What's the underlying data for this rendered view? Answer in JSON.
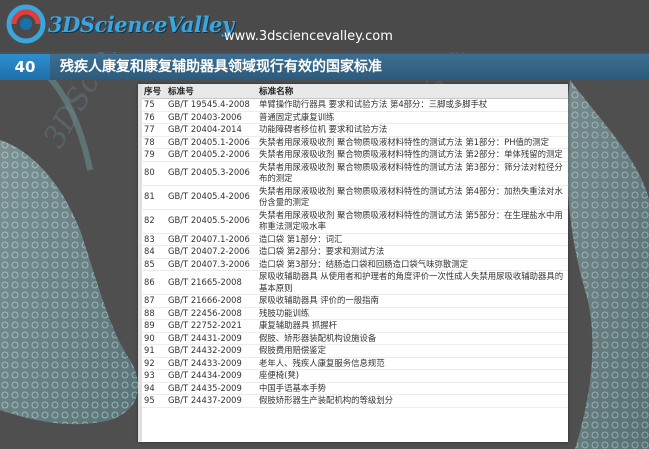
{
  "header": {
    "logo_text": "3DScienceValley",
    "url": "www.3dsciencevalley.com"
  },
  "title_bar": {
    "number": "40",
    "title": "残疾人康复和康复辅助器具领域现行有效的国家标准"
  },
  "table": {
    "headers": [
      "序号",
      "标准号",
      "标准名称"
    ],
    "rows": [
      {
        "no": "75",
        "code": "GB/T 19545.4-2008",
        "name": "单臂操作助行器具 要求和试验方法 第4部分：三脚或多脚手杖"
      },
      {
        "no": "76",
        "code": "GB/T 20403-2006",
        "name": "普通固定式康复训练"
      },
      {
        "no": "77",
        "code": "GB/T 20404-2014",
        "name": "功能障碍者移位机 要求和试验方法"
      },
      {
        "no": "78",
        "code": "GB/T 20405.1-2006",
        "name": "失禁者用尿液吸收剂 聚合物质吸液材料特性的测试方法 第1部分：PH值的测定"
      },
      {
        "no": "79",
        "code": "GB/T 20405.2-2006",
        "name": "失禁者用尿液吸收剂 聚合物质吸液材料特性的测试方法 第2部分：单体残留的测定"
      },
      {
        "no": "80",
        "code": "GB/T 20405.3-2006",
        "name": "失禁者用尿液吸收剂 聚合物质吸液材料特性的测试方法 第3部分：筛分法对粒径分布的测定"
      },
      {
        "no": "81",
        "code": "GB/T 20405.4-2006",
        "name": "失禁者用尿液吸收剂 聚合物质吸液材料特性的测试方法 第4部分：加热失重法对水份含量的测定"
      },
      {
        "no": "82",
        "code": "GB/T 20405.5-2006",
        "name": "失禁者用尿液吸收剂 聚合物质吸液材料特性的测试方法 第5部分：在生理盐水中用称重法测定吸水率"
      },
      {
        "no": "83",
        "code": "GB/T 20407.1-2006",
        "name": "造口袋 第1部分：词汇"
      },
      {
        "no": "84",
        "code": "GB/T 20407.2-2006",
        "name": "造口袋 第2部分：要求和测试方法"
      },
      {
        "no": "85",
        "code": "GB/T 20407.3-2006",
        "name": "造口袋 第3部分：结肠造口袋和回肠造口袋气味弥散测定"
      },
      {
        "no": "86",
        "code": "GB/T 21665-2008",
        "name": "尿吸收辅助器具 从使用者和护理者的角度评价一次性成人失禁用尿吸收辅助器具的基本原则"
      },
      {
        "no": "87",
        "code": "GB/T 21666-2008",
        "name": "尿吸收辅助器具 评价的一般指南"
      },
      {
        "no": "88",
        "code": "GB/T 22456-2008",
        "name": "残肢功能训练"
      },
      {
        "no": "89",
        "code": "GB/T 22752-2021",
        "name": "康复辅助器具 抓握杆"
      },
      {
        "no": "90",
        "code": "GB/T 24431-2009",
        "name": "假肢、矫形器装配机构设施设备"
      },
      {
        "no": "91",
        "code": "GB/T 24432-2009",
        "name": "假肢费用赔偿鉴定"
      },
      {
        "no": "92",
        "code": "GB/T 24433-2009",
        "name": "老年人、残疾人康复服务信息规范"
      },
      {
        "no": "93",
        "code": "GB/T 24434-2009",
        "name": "座便椅(凳)"
      },
      {
        "no": "94",
        "code": "GB/T 24435-2009",
        "name": "中国手语基本手势"
      },
      {
        "no": "95",
        "code": "GB/T 24437-2009",
        "name": "假肢矫形器生产装配机构的等级划分"
      }
    ]
  },
  "colors": {
    "background": "#4f4f4f",
    "title_bar": "#2d5a7b",
    "number_badge": "#2d8fd0",
    "logo_blue": "#3aa6dd",
    "logo_red": "#e43b3b"
  },
  "icons": {
    "logo": "3d-science-valley-logo-icon"
  }
}
